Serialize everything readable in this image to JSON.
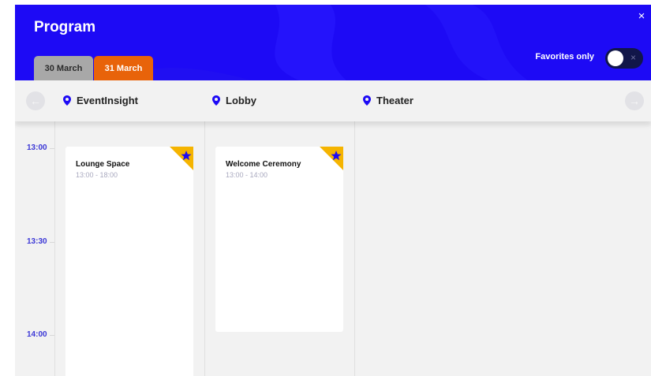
{
  "header": {
    "title": "Program",
    "close_symbol": "×",
    "tabs": [
      {
        "label": "30 March"
      },
      {
        "label": "31 March"
      }
    ],
    "favorites_label": "Favorites only",
    "toggle_symbol": "×"
  },
  "colors": {
    "header_blue": "#1d0af5",
    "active_tab": "#e8630a",
    "inactive_tab": "#a8a8a8",
    "favorite_badge": "#f5b400",
    "time_label": "#3b37d6"
  },
  "nav": {
    "prev_symbol": "←",
    "next_symbol": "→"
  },
  "rooms": [
    {
      "name": "EventInsight",
      "icon": "map-pin-icon"
    },
    {
      "name": "Lobby",
      "icon": "map-pin-icon"
    },
    {
      "name": "Theater",
      "icon": "map-pin-icon"
    }
  ],
  "times": [
    "13:00",
    "13:30",
    "14:00"
  ],
  "sessions": [
    {
      "title": "Lounge Space",
      "time": "13:00 - 18:00",
      "favorite": true,
      "icon": "star-icon"
    },
    {
      "title": "Welcome Ceremony",
      "time": "13:00 - 14:00",
      "favorite": true,
      "icon": "star-icon"
    }
  ]
}
